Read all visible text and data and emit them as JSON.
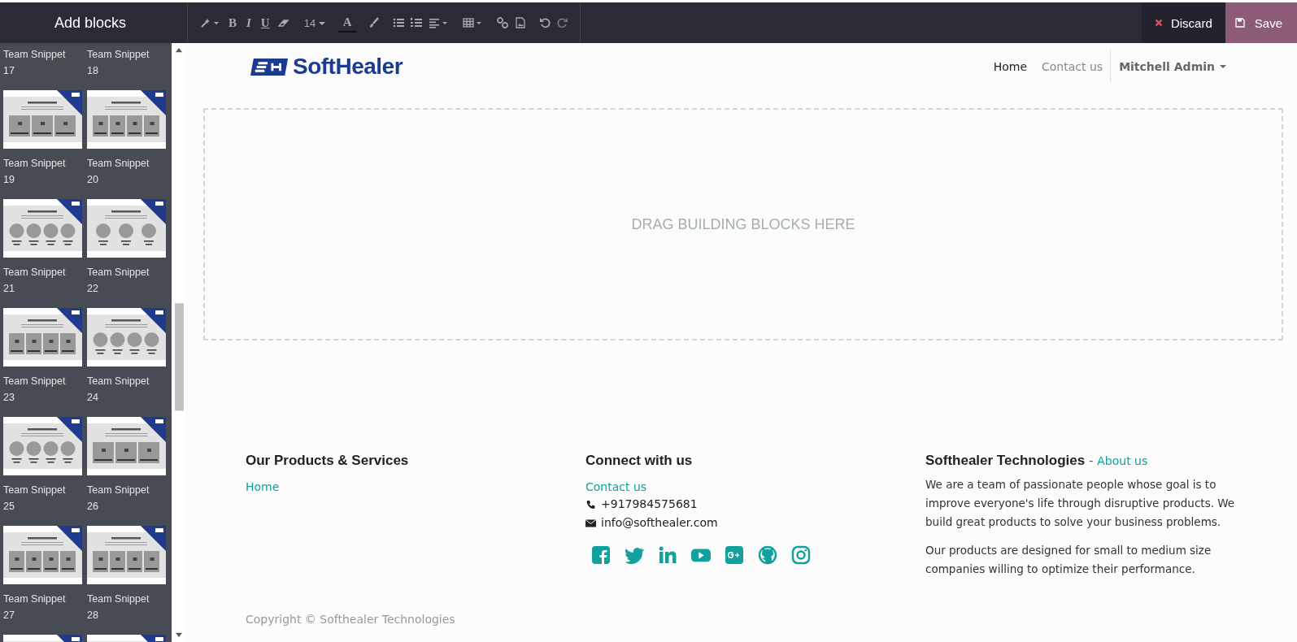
{
  "toolbar": {
    "title": "Add blocks",
    "font_size": "14",
    "bold": "B",
    "italic": "I",
    "underline": "U",
    "text_color": "A",
    "discard": "Discard",
    "save": "Save"
  },
  "sidebar": {
    "items": [
      {
        "kind": "label-only",
        "label": "Team Snippet",
        "number": "17"
      },
      {
        "kind": "label-only",
        "label": "Team Snippet",
        "number": "18"
      },
      {
        "kind": "cards-3",
        "label": "Team Snippet",
        "number": "19"
      },
      {
        "kind": "cards-4",
        "label": "Team Snippet",
        "number": "20"
      },
      {
        "kind": "circles-4",
        "label": "Team Snippet",
        "number": "21"
      },
      {
        "kind": "circles-3",
        "label": "Team Snippet",
        "number": "22"
      },
      {
        "kind": "cards-4",
        "label": "Team Snippet",
        "number": "23"
      },
      {
        "kind": "circles-4",
        "label": "Team Snippet",
        "number": "24"
      },
      {
        "kind": "circles-4",
        "label": "Team Snippet",
        "number": "25"
      },
      {
        "kind": "cards-3",
        "label": "Team Snippet",
        "number": "26"
      },
      {
        "kind": "cards-4",
        "label": "Team Snippet",
        "number": "27"
      },
      {
        "kind": "cards-4",
        "label": "Team Snippet",
        "number": "28"
      },
      {
        "kind": "thumb-only"
      },
      {
        "kind": "thumb-only"
      }
    ]
  },
  "header": {
    "logo": "SoftHealer",
    "nav": [
      {
        "label": "Home",
        "selected": true
      },
      {
        "label": "Contact us",
        "selected": false
      }
    ],
    "user": "Mitchell Admin"
  },
  "dropzone": "DRAG BUILDING BLOCKS HERE",
  "footer": {
    "products": {
      "title": "Our Products & Services",
      "links": [
        "Home"
      ]
    },
    "connect": {
      "title": "Connect with us",
      "link": "Contact us",
      "phone": "+917984575681",
      "email": "info@softhealer.com",
      "social": [
        {
          "kind": "facebook"
        },
        {
          "kind": "twitter"
        },
        {
          "kind": "linkedin"
        },
        {
          "kind": "youtube"
        },
        {
          "kind": "google-plus"
        },
        {
          "kind": "github"
        },
        {
          "kind": "instagram"
        }
      ]
    },
    "about": {
      "title": "Softhealer Technologies",
      "separator": "-",
      "link": "About us",
      "paragraphs": [
        "We are a team of passionate people whose goal is to improve everyone's life through disruptive products. We build great products to solve your business problems.",
        "Our products are designed for small to medium size companies willing to optimize their performance."
      ]
    },
    "copyright": "Copyright © Softhealer Technologies"
  }
}
